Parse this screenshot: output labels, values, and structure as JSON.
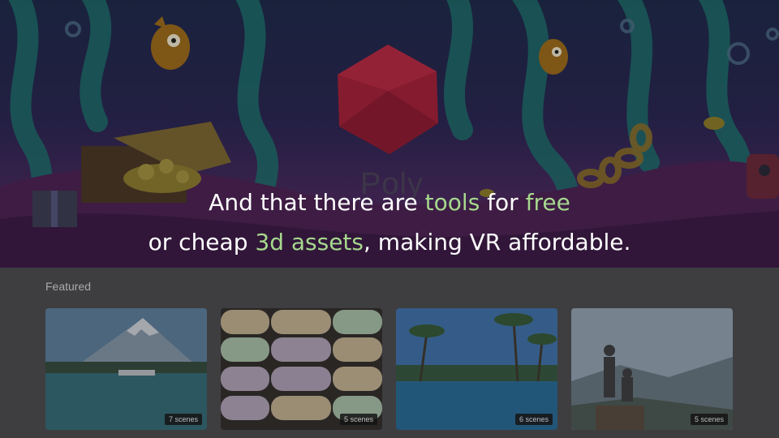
{
  "hero": {
    "wordmark": "Poly"
  },
  "caption": {
    "line1_a": "And that there are ",
    "line1_b": "tools",
    "line1_c": " for ",
    "line1_d": "free",
    "line2_a": "or cheap ",
    "line2_b": "3d assets",
    "line2_c": ", making VR affordable.",
    "highlight_color": "#a6d88d"
  },
  "gallery": {
    "section_title": "Featured",
    "cards": [
      {
        "badge": "7 scenes",
        "icon": "mountain-lake-thumbnail"
      },
      {
        "badge": "5 scenes",
        "icon": "macarons-thumbnail"
      },
      {
        "badge": "6 scenes",
        "icon": "tropical-pool-thumbnail"
      },
      {
        "badge": "5 scenes",
        "icon": "hikers-thumbnail"
      }
    ]
  }
}
